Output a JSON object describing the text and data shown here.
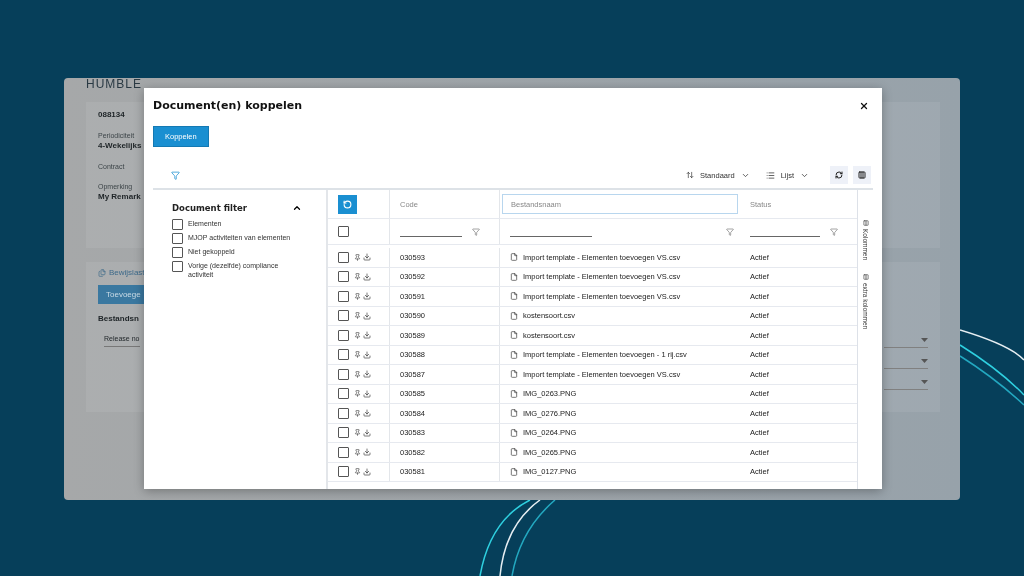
{
  "background_app": {
    "logo": "HUMBLE",
    "fields": [
      {
        "value": "088134"
      },
      {
        "label": "Periodiciteit",
        "value": "4-Wekelijks"
      },
      {
        "label": "Contract"
      },
      {
        "label": "Opmerking",
        "value": "My Remark"
      }
    ],
    "section": {
      "title": "Bewijslast",
      "button": "Toevoege",
      "column": "Bestandsn",
      "row": "Release no"
    }
  },
  "dialog": {
    "title": "Document(en) koppelen",
    "primary_button": "Koppelen",
    "toolbar": {
      "sort": "Standaard",
      "view": "Lijst"
    },
    "filter_panel": {
      "title": "Document filter",
      "expanded": true,
      "items": [
        {
          "label": "Elementen",
          "checked": false
        },
        {
          "label": "MJOP activiteiten van elementen",
          "checked": false
        },
        {
          "label": "Niet gekoppeld",
          "checked": false
        },
        {
          "label": "Vorige (dezelfde) compliance activiteit",
          "checked": false
        }
      ]
    },
    "table": {
      "columns": [
        "Code",
        "Bestandsnaam",
        "Status"
      ],
      "select_all": {
        "checked": false
      },
      "rows": [
        {
          "code": "030593",
          "name": "Import template - Elementen toevoegen VS.csv",
          "status": "Actief",
          "checked": false
        },
        {
          "code": "030592",
          "name": "Import template - Elementen toevoegen VS.csv",
          "status": "Actief",
          "checked": false
        },
        {
          "code": "030591",
          "name": "Import template - Elementen toevoegen VS.csv",
          "status": "Actief",
          "checked": false
        },
        {
          "code": "030590",
          "name": "kostensoort.csv",
          "status": "Actief",
          "checked": false
        },
        {
          "code": "030589",
          "name": "kostensoort.csv",
          "status": "Actief",
          "checked": false
        },
        {
          "code": "030588",
          "name": "Import template - Elementen toevoegen - 1 rij.csv",
          "status": "Actief",
          "checked": false
        },
        {
          "code": "030587",
          "name": "Import template - Elementen toevoegen VS.csv",
          "status": "Actief",
          "checked": false
        },
        {
          "code": "030585",
          "name": "IMG_0263.PNG",
          "status": "Actief",
          "checked": false
        },
        {
          "code": "030584",
          "name": "IMG_0276.PNG",
          "status": "Actief",
          "checked": false
        },
        {
          "code": "030583",
          "name": "IMG_0264.PNG",
          "status": "Actief",
          "checked": false
        },
        {
          "code": "030582",
          "name": "IMG_0265.PNG",
          "status": "Actief",
          "checked": false
        },
        {
          "code": "030581",
          "name": "IMG_0127.PNG",
          "status": "Actief",
          "checked": false
        }
      ]
    },
    "side_tabs": [
      "Kolommen",
      "extra kolommen"
    ]
  }
}
